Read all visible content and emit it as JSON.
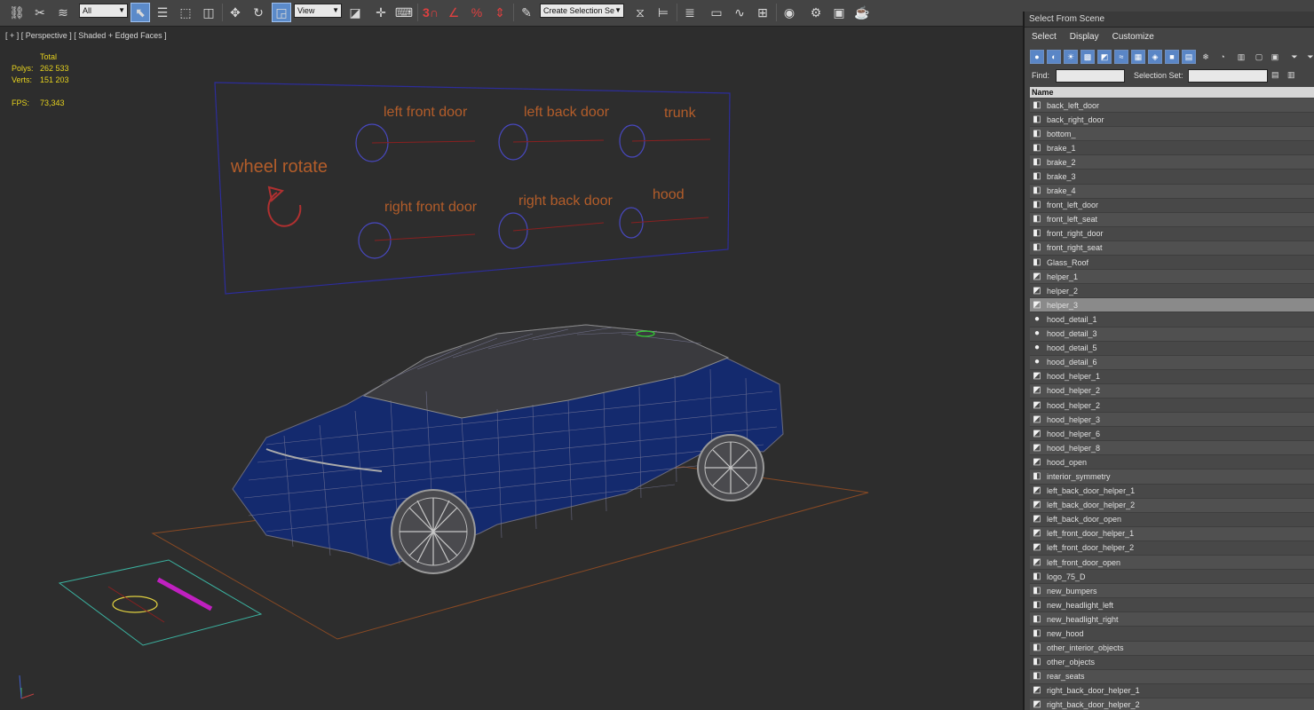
{
  "toolbar": {
    "filter_select": "All",
    "view_select": "View",
    "selection_set_select": "Create Selection Se",
    "snap_label": "3",
    "icons": [
      "link-icon",
      "unlink-icon",
      "bind-spacewarp-icon",
      "select-object-icon",
      "select-by-name-icon",
      "rect-select-icon",
      "window-crossing-icon",
      "move-icon",
      "rotate-icon",
      "scale-icon",
      "pivot-icon",
      "select-manipulate-icon",
      "keyboard-shortcut-icon",
      "snap-toggle-icon",
      "angle-snap-icon",
      "percent-snap-icon",
      "spinner-snap-icon",
      "edit-named-selection-icon",
      "mirror-icon",
      "align-icon",
      "layer-explorer-icon",
      "scene-explorer-icon",
      "curve-editor-icon",
      "schematic-view-icon",
      "material-editor-icon",
      "render-setup-icon",
      "render-frame-icon",
      "render-icon"
    ]
  },
  "viewport": {
    "label": "[ + ] [ Perspective ] [ Shaded + Edged Faces ]",
    "stats": {
      "total_label": "Total",
      "polys_label": "Polys:",
      "polys_value": "262 533",
      "verts_label": "Verts:",
      "verts_value": "151 203",
      "fps_label": "FPS:",
      "fps_value": "73,343"
    },
    "controller_labels": {
      "wheel_rotate": "wheel rotate",
      "left_front_door": "left front door",
      "left_back_door": "left back door",
      "trunk": "trunk",
      "right_front_door": "right front door",
      "right_back_door": "right back door",
      "hood": "hood"
    }
  },
  "panel": {
    "title": "Select From Scene",
    "menu": [
      "Select",
      "Display",
      "Customize"
    ],
    "find_label": "Find:",
    "find_value": "",
    "selection_set_label": "Selection Set:",
    "selection_set_value": "",
    "column_header": "Name",
    "items": [
      {
        "name": "back_left_door",
        "icon": "geometry-icon"
      },
      {
        "name": "back_right_door",
        "icon": "geometry-icon"
      },
      {
        "name": "bottom_",
        "icon": "geometry-icon"
      },
      {
        "name": "brake_1",
        "icon": "geometry-icon"
      },
      {
        "name": "brake_2",
        "icon": "geometry-icon"
      },
      {
        "name": "brake_3",
        "icon": "geometry-icon"
      },
      {
        "name": "brake_4",
        "icon": "geometry-icon"
      },
      {
        "name": "front_left_door",
        "icon": "geometry-icon"
      },
      {
        "name": "front_left_seat",
        "icon": "geometry-icon"
      },
      {
        "name": "front_right_door",
        "icon": "geometry-icon"
      },
      {
        "name": "front_right_seat",
        "icon": "geometry-icon"
      },
      {
        "name": "Glass_Roof",
        "icon": "geometry-icon"
      },
      {
        "name": "helper_1",
        "icon": "helper-icon"
      },
      {
        "name": "helper_2",
        "icon": "helper-icon"
      },
      {
        "name": "helper_3",
        "icon": "helper-icon",
        "selected": true
      },
      {
        "name": "hood_detail_1",
        "icon": "shape-icon"
      },
      {
        "name": "hood_detail_3",
        "icon": "shape-icon"
      },
      {
        "name": "hood_detail_5",
        "icon": "shape-icon"
      },
      {
        "name": "hood_detail_6",
        "icon": "shape-icon"
      },
      {
        "name": "hood_helper_1",
        "icon": "helper-icon"
      },
      {
        "name": "hood_helper_2",
        "icon": "helper-icon"
      },
      {
        "name": "hood_helper_2",
        "icon": "helper-icon"
      },
      {
        "name": "hood_helper_3",
        "icon": "helper-icon"
      },
      {
        "name": "hood_helper_6",
        "icon": "helper-icon"
      },
      {
        "name": "hood_helper_8",
        "icon": "helper-icon"
      },
      {
        "name": "hood_open",
        "icon": "helper-icon"
      },
      {
        "name": "interior_symmetry",
        "icon": "geometry-icon"
      },
      {
        "name": "left_back_door_helper_1",
        "icon": "helper-icon"
      },
      {
        "name": "left_back_door_helper_2",
        "icon": "helper-icon"
      },
      {
        "name": "left_back_door_open",
        "icon": "helper-icon"
      },
      {
        "name": "left_front_door_helper_1",
        "icon": "helper-icon"
      },
      {
        "name": "left_front_door_helper_2",
        "icon": "helper-icon"
      },
      {
        "name": "left_front_door_open",
        "icon": "helper-icon"
      },
      {
        "name": "logo_75_D",
        "icon": "geometry-icon"
      },
      {
        "name": "new_bumpers",
        "icon": "geometry-icon"
      },
      {
        "name": "new_headlight_left",
        "icon": "geometry-icon"
      },
      {
        "name": "new_headlight_right",
        "icon": "geometry-icon"
      },
      {
        "name": "new_hood",
        "icon": "geometry-icon"
      },
      {
        "name": "other_interior_objects",
        "icon": "geometry-icon"
      },
      {
        "name": "other_objects",
        "icon": "geometry-icon"
      },
      {
        "name": "rear_seats",
        "icon": "geometry-icon"
      },
      {
        "name": "right_back_door_helper_1",
        "icon": "helper-icon"
      },
      {
        "name": "right_back_door_helper_2",
        "icon": "helper-icon"
      }
    ]
  },
  "colors": {
    "controller_text": "#b35d2a",
    "controller_frame": "#2d2d9a",
    "car_body": "#142a6e",
    "stats_text": "#e6d21e",
    "panel_bg": "#444444"
  }
}
